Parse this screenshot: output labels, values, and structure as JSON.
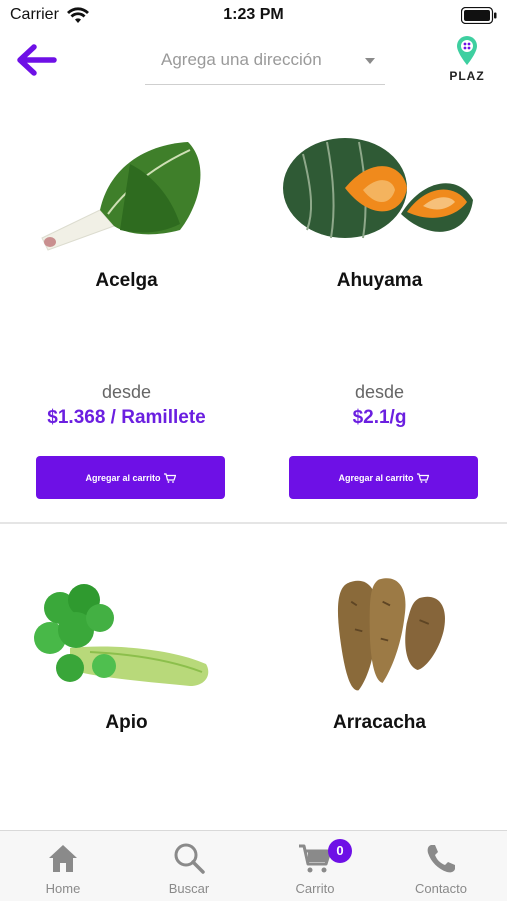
{
  "status": {
    "carrier": "Carrier",
    "time": "1:23 PM"
  },
  "header": {
    "address_placeholder": "Agrega una dirección",
    "logo_text": "PLAZ"
  },
  "products": [
    {
      "name": "Acelga",
      "from": "desde",
      "price": "$1.368 / Ramillete",
      "button": "Agregar al carrito"
    },
    {
      "name": "Ahuyama",
      "from": "desde",
      "price": "$2.1/g",
      "button": "Agregar al carrito"
    },
    {
      "name": "Apio"
    },
    {
      "name": "Arracacha"
    }
  ],
  "tabs": [
    {
      "label": "Home",
      "icon": "home-icon"
    },
    {
      "label": "Buscar",
      "icon": "search-icon"
    },
    {
      "label": "Carrito",
      "icon": "cart-icon",
      "badge": "0"
    },
    {
      "label": "Contacto",
      "icon": "phone-icon"
    }
  ],
  "colors": {
    "accent": "#6e10e6",
    "price": "#6b1fe0",
    "muted": "#8a8a8a"
  }
}
